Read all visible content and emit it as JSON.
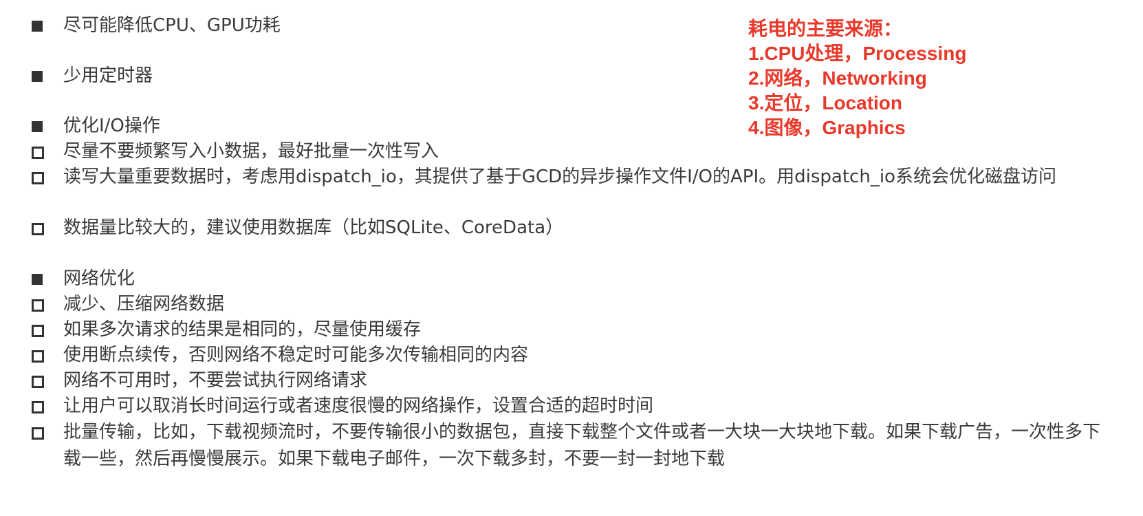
{
  "sections": {
    "cpu_gpu": {
      "title": "尽可能降低CPU、GPU功耗"
    },
    "timers": {
      "title": "少用定时器"
    },
    "io": {
      "title": "优化I/O操作",
      "items": [
        "尽量不要频繁写入小数据，最好批量一次性写入",
        "读写大量重要数据时，考虑用dispatch_io，其提供了基于GCD的异步操作文件I/O的API。用dispatch_io系统会优化磁盘访问",
        "数据量比较大的，建议使用数据库（比如SQLite、CoreData）"
      ]
    },
    "network": {
      "title": "网络优化",
      "items": [
        "减少、压缩网络数据",
        "如果多次请求的结果是相同的，尽量使用缓存",
        "使用断点续传，否则网络不稳定时可能多次传输相同的内容",
        "网络不可用时，不要尝试执行网络请求",
        "让用户可以取消长时间运行或者速度很慢的网络操作，设置合适的超时时间",
        "批量传输，比如，下载视频流时，不要传输很小的数据包，直接下载整个文件或者一大块一大块地下载。如果下载广告，一次性多下载一些，然后再慢慢展示。如果下载电子邮件，一次下载多封，不要一封一封地下载"
      ]
    }
  },
  "note": {
    "heading": "耗电的主要来源：",
    "lines": [
      "1.CPU处理，Processing",
      "2.网络，Networking",
      "3.定位，Location",
      "4.图像，Graphics"
    ]
  },
  "colors": {
    "text": "#3a3a3a",
    "note": "#e8392a",
    "bullet": "#333333"
  }
}
